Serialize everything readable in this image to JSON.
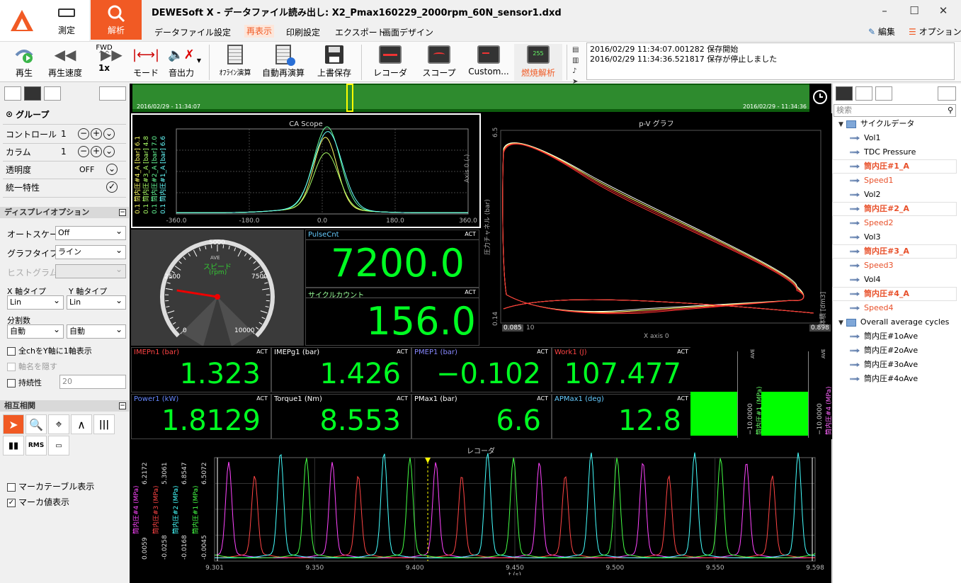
{
  "app": {
    "title": "DEWESoft X - データファイル読み出し: X2_Pmax160229_2000rpm_60N_sensor1.dxd",
    "measure_label": "測定",
    "analyze_label": "解析",
    "edit_label": "編集",
    "option_label": "オプション"
  },
  "menu": [
    "データファイル",
    "設定",
    "再表示",
    "印刷設定",
    "エクスポート",
    "画面デザイン"
  ],
  "toolbar": {
    "play": "再生",
    "speed": "再生速度",
    "fwd": "FWD",
    "speed_value": "1x",
    "mode": "モード",
    "audio": "音出力",
    "offline": "ｵﾌﾗｲﾝ演算",
    "auto_recalc": "自動再演算",
    "save": "上書保存",
    "recorder": "レコーダ",
    "scope": "スコープ",
    "custom": "Custom...",
    "combustion": "燃焼解析"
  },
  "log": [
    "2016/02/29 11:34:07.001282 保存開始",
    "2016/02/29 11:34:36.521817 保存が停止しました"
  ],
  "left_panel": {
    "group": "グループ",
    "rows": [
      {
        "label": "コントロール",
        "value": "1"
      },
      {
        "label": "カラム",
        "value": "1"
      },
      {
        "label": "透明度",
        "value": "OFF"
      },
      {
        "label": "統一特性",
        "value": ""
      }
    ],
    "display_options": "ディスプレイオプション",
    "auto_scale_label": "オートスケール",
    "auto_scale": "Off",
    "graph_type_label": "グラフタイプ",
    "graph_type": "ライン",
    "histogram_label": "ヒストグラム タ",
    "x_axis_label": "X 軸タイプ",
    "y_axis_label": "Y 軸タイプ",
    "x_axis": "Lin",
    "y_axis": "Lin",
    "divisions_label": "分割数",
    "div_a": "自動",
    "div_b": "自動",
    "all_ch": "全chをY軸に1軸表示",
    "hide_axis": "軸名を隠す",
    "persistence": "持続性",
    "persistence_value": "20",
    "interaction": "相互相関",
    "rms": "RMS",
    "marker_table": "マーカテーブル表示",
    "marker_value": "マーカ値表示"
  },
  "overview": {
    "start": "2016/02/29 - 11:34:07",
    "end": "2016/02/29 - 11:34:36"
  },
  "ca_scope": {
    "title": "CA Scope",
    "axis0": "Axis 0 (-)",
    "channels": [
      {
        "name": "筒内圧#4_A [bar]",
        "max": "6.1",
        "min": "0.1",
        "color": "#ffff66"
      },
      {
        "name": "筒内圧#3_A [bar]",
        "max": "4.8",
        "min": "0.1",
        "color": "#aaff66"
      },
      {
        "name": "筒内圧#2_A [bar]",
        "max": "7.0",
        "min": "0.1",
        "color": "#66ff99"
      },
      {
        "name": "筒内圧#1_A [bar]",
        "max": "6.6",
        "min": "0.1",
        "color": "#66ffff"
      }
    ],
    "xticks": [
      "-360.0",
      "-180.0",
      "0.0",
      "180.0",
      "360.0"
    ]
  },
  "pv": {
    "title": "p-V グラフ",
    "ylabel": "圧力チャネル (bar)",
    "ymax": "6.5",
    "ymin": "0.14",
    "xmin": "0.085",
    "xmax": "0.898",
    "xlabel": "X axis 0",
    "x2label": "体積 [dm3]",
    "tiny": "10"
  },
  "gauge": {
    "title": "スピード",
    "unit": "(rpm)",
    "ave": "AVE",
    "ticks": [
      "0",
      "2500",
      "5000",
      "7500",
      "10000"
    ],
    "value_rpm": 2000,
    "max_rpm": 10000
  },
  "digital": [
    {
      "name": "PulseCnt",
      "value": "7200.0",
      "color": "#66ccff"
    },
    {
      "name": "サイクルカウント",
      "value": "156.0",
      "color": "#99ff99"
    }
  ],
  "meters_row1": [
    {
      "name": "IMEPn1 (bar)",
      "value": "1.323",
      "color": "#ff4444"
    },
    {
      "name": "IMEPg1 (bar)",
      "value": "1.426",
      "color": "#ffffff"
    },
    {
      "name": "PMEP1 (bar)",
      "value": "−0.102",
      "color": "#8888ff"
    },
    {
      "name": "Work1 (J)",
      "value": "107.477",
      "color": "#ff4444"
    }
  ],
  "meters_row2": [
    {
      "name": "Power1 (kW)",
      "value": "1.8129",
      "color": "#6688ff"
    },
    {
      "name": "Torque1 (Nm)",
      "value": "8.553",
      "color": "#ffffff"
    },
    {
      "name": "PMax1 (bar)",
      "value": "6.6",
      "color": "#ffffff"
    },
    {
      "name": "APMax1 (deg)",
      "value": "12.8",
      "color": "#66ccff"
    }
  ],
  "act": "ACT",
  "bars": [
    {
      "label": "筒内圧#1 (MPa)",
      "min": "−10.0000",
      "ave": "AVE",
      "color": "#66ff66"
    },
    {
      "label": "筒内圧#4 (MPa)",
      "min": "−10.0000",
      "ave": "AVE",
      "color": "#ff66ff"
    }
  ],
  "recorder": {
    "title": "レコーダ",
    "xlabel": "t (s)",
    "xticks": [
      "9.301",
      "9.350",
      "9.400",
      "9.450",
      "9.500",
      "9.550",
      "9.598"
    ],
    "channels": [
      {
        "name": "筒内圧#4 (MPa)",
        "max": "6.2172",
        "min": "0.0059",
        "color": "#ff44ff"
      },
      {
        "name": "筒内圧#3 (MPa)",
        "max": "5.3061",
        "min": "-0.0258",
        "color": "#ff4444"
      },
      {
        "name": "筒内圧#2 (MPa)",
        "max": "6.8547",
        "min": "-0.0168",
        "color": "#44ffff"
      },
      {
        "name": "筒内圧#1 (MPa)",
        "max": "6.5072",
        "min": "-0.0045",
        "color": "#44ff44"
      }
    ]
  },
  "right_panel": {
    "search": "検索",
    "tree": [
      {
        "label": "サイクルデータ",
        "kind": "folder",
        "color": "#000000",
        "hl": false
      },
      {
        "label": "Vol1",
        "kind": "leaf",
        "color": "#000000",
        "hl": false
      },
      {
        "label": "TDC Pressure",
        "kind": "leaf",
        "color": "#000000",
        "hl": false
      },
      {
        "label": "筒内圧#1_A",
        "kind": "leaf",
        "color": "#e8502a",
        "hl": true
      },
      {
        "label": "Speed1",
        "kind": "leaf",
        "color": "#e8502a",
        "hl": false
      },
      {
        "label": "Vol2",
        "kind": "leaf",
        "color": "#000000",
        "hl": false
      },
      {
        "label": "筒内圧#2_A",
        "kind": "leaf",
        "color": "#e8502a",
        "hl": true
      },
      {
        "label": "Speed2",
        "kind": "leaf",
        "color": "#e8502a",
        "hl": false
      },
      {
        "label": "Vol3",
        "kind": "leaf",
        "color": "#000000",
        "hl": false
      },
      {
        "label": "筒内圧#3_A",
        "kind": "leaf",
        "color": "#e8502a",
        "hl": true
      },
      {
        "label": "Speed3",
        "kind": "leaf",
        "color": "#e8502a",
        "hl": false
      },
      {
        "label": "Vol4",
        "kind": "leaf",
        "color": "#000000",
        "hl": false
      },
      {
        "label": "筒内圧#4_A",
        "kind": "leaf",
        "color": "#e8502a",
        "hl": true
      },
      {
        "label": "Speed4",
        "kind": "leaf",
        "color": "#e8502a",
        "hl": false
      },
      {
        "label": "Overall average cycles",
        "kind": "folder",
        "color": "#000000",
        "hl": false
      },
      {
        "label": "筒内圧#1oAve",
        "kind": "leaf",
        "color": "#000000",
        "hl": false
      },
      {
        "label": "筒内圧#2oAve",
        "kind": "leaf",
        "color": "#000000",
        "hl": false
      },
      {
        "label": "筒内圧#3oAve",
        "kind": "leaf",
        "color": "#000000",
        "hl": false
      },
      {
        "label": "筒内圧#4oAve",
        "kind": "leaf",
        "color": "#000000",
        "hl": false
      }
    ]
  }
}
